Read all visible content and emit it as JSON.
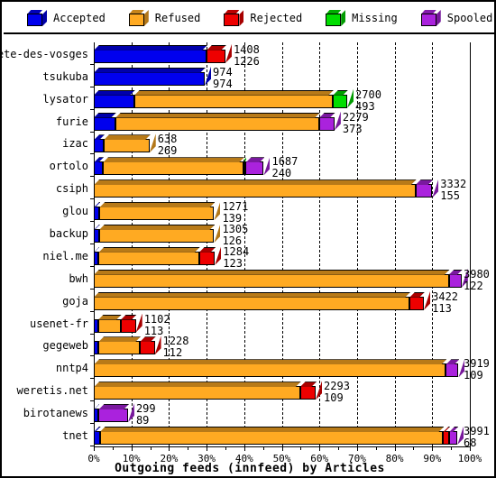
{
  "legend": {
    "items": [
      {
        "label": "Accepted",
        "color": "#0000ee",
        "icon": "cube-icon"
      },
      {
        "label": "Refused",
        "color": "#ffaa22",
        "icon": "cube-icon"
      },
      {
        "label": "Rejected",
        "color": "#ee0000",
        "icon": "cube-icon"
      },
      {
        "label": "Missing",
        "color": "#00dd00",
        "icon": "cube-icon"
      },
      {
        "label": "Spooled",
        "color": "#aa22dd",
        "icon": "cube-icon"
      }
    ]
  },
  "axis": {
    "x_ticks": [
      "0%",
      "10%",
      "20%",
      "30%",
      "40%",
      "50%",
      "60%",
      "70%",
      "80%",
      "90%",
      "100%"
    ],
    "title": "Outgoing feeds (innfeed) by Articles"
  },
  "chart_data": {
    "type": "bar",
    "orientation": "horizontal",
    "stacked": true,
    "title": "Outgoing feeds (innfeed) by Articles",
    "xlabel": "Outgoing feeds (innfeed) by Articles",
    "ylabel": "",
    "xlim": [
      0,
      100
    ],
    "x_unit": "percent",
    "grid": true,
    "legend_position": "top",
    "series_names": [
      "Accepted",
      "Refused",
      "Rejected",
      "Missing",
      "Spooled"
    ],
    "series_colors": [
      "#0000ee",
      "#ffaa22",
      "#ee0000",
      "#00dd00",
      "#aa22dd"
    ],
    "categories": [
      "bete-des-vosges",
      "tsukuba",
      "lysator",
      "furie",
      "izac",
      "ortolo",
      "csiph",
      "glou",
      "backup",
      "niel.me",
      "bwh",
      "goja",
      "usenet-fr",
      "gegeweb",
      "nntp4",
      "weretis.net",
      "birotanews",
      "tnet"
    ],
    "rows": [
      {
        "category": "bete-des-vosges",
        "label_top": "1408",
        "label_bottom": "1226",
        "segments": [
          {
            "name": "Accepted",
            "pct": 30.0
          },
          {
            "name": "Rejected",
            "pct": 5.0
          }
        ]
      },
      {
        "category": "tsukuba",
        "label_top": "974",
        "label_bottom": "974",
        "segments": [
          {
            "name": "Accepted",
            "pct": 29.5
          }
        ]
      },
      {
        "category": "lysator",
        "label_top": "2700",
        "label_bottom": "493",
        "segments": [
          {
            "name": "Accepted",
            "pct": 10.8
          },
          {
            "name": "Refused",
            "pct": 52.8
          },
          {
            "name": "Missing",
            "pct": 3.8
          }
        ]
      },
      {
        "category": "furie",
        "label_top": "2279",
        "label_bottom": "373",
        "segments": [
          {
            "name": "Accepted",
            "pct": 5.8
          },
          {
            "name": "Refused",
            "pct": 54.2
          },
          {
            "name": "Spooled",
            "pct": 4.0
          }
        ]
      },
      {
        "category": "izac",
        "label_top": "638",
        "label_bottom": "269",
        "segments": [
          {
            "name": "Accepted",
            "pct": 2.6
          },
          {
            "name": "Refused",
            "pct": 12.2
          }
        ]
      },
      {
        "category": "ortolo",
        "label_top": "1687",
        "label_bottom": "240",
        "segments": [
          {
            "name": "Accepted",
            "pct": 2.4
          },
          {
            "name": "Refused",
            "pct": 37.4
          },
          {
            "name": "Missing",
            "pct": 0.6
          },
          {
            "name": "Spooled",
            "pct": 4.8
          }
        ]
      },
      {
        "category": "csiph",
        "label_top": "3332",
        "label_bottom": "155",
        "segments": [
          {
            "name": "Refused",
            "pct": 85.5
          },
          {
            "name": "Spooled",
            "pct": 4.5
          }
        ]
      },
      {
        "category": "glou",
        "label_top": "1271",
        "label_bottom": "139",
        "segments": [
          {
            "name": "Accepted",
            "pct": 1.5
          },
          {
            "name": "Refused",
            "pct": 30.5
          }
        ]
      },
      {
        "category": "backup",
        "label_top": "1305",
        "label_bottom": "126",
        "segments": [
          {
            "name": "Accepted",
            "pct": 1.4
          },
          {
            "name": "Refused",
            "pct": 30.6
          }
        ]
      },
      {
        "category": "niel.me",
        "label_top": "1284",
        "label_bottom": "123",
        "segments": [
          {
            "name": "Accepted",
            "pct": 1.3
          },
          {
            "name": "Refused",
            "pct": 26.7
          },
          {
            "name": "Rejected",
            "pct": 4.2
          }
        ]
      },
      {
        "category": "bwh",
        "label_top": "3980",
        "label_bottom": "122",
        "segments": [
          {
            "name": "Refused",
            "pct": 94.4
          },
          {
            "name": "Spooled",
            "pct": 3.4
          }
        ]
      },
      {
        "category": "goja",
        "label_top": "3422",
        "label_bottom": "113",
        "segments": [
          {
            "name": "Refused",
            "pct": 84.0
          },
          {
            "name": "Rejected",
            "pct": 3.8
          }
        ]
      },
      {
        "category": "usenet-fr",
        "label_top": "1102",
        "label_bottom": "113",
        "segments": [
          {
            "name": "Accepted",
            "pct": 1.2
          },
          {
            "name": "Refused",
            "pct": 6.0
          },
          {
            "name": "Rejected",
            "pct": 4.0
          }
        ]
      },
      {
        "category": "gegeweb",
        "label_top": "1228",
        "label_bottom": "112",
        "segments": [
          {
            "name": "Accepted",
            "pct": 1.2
          },
          {
            "name": "Refused",
            "pct": 11.0
          },
          {
            "name": "Rejected",
            "pct": 4.0
          }
        ]
      },
      {
        "category": "nntp4",
        "label_top": "3919",
        "label_bottom": "109",
        "segments": [
          {
            "name": "Refused",
            "pct": 93.6
          },
          {
            "name": "Spooled",
            "pct": 3.4
          }
        ]
      },
      {
        "category": "weretis.net",
        "label_top": "2293",
        "label_bottom": "109",
        "segments": [
          {
            "name": "Refused",
            "pct": 54.8
          },
          {
            "name": "Rejected",
            "pct": 4.2
          }
        ]
      },
      {
        "category": "birotanews",
        "label_top": "299",
        "label_bottom": "89",
        "segments": [
          {
            "name": "Accepted",
            "pct": 1.3
          },
          {
            "name": "Spooled",
            "pct": 7.8
          }
        ]
      },
      {
        "category": "tnet",
        "label_top": "3991",
        "label_bottom": "68",
        "segments": [
          {
            "name": "Accepted",
            "pct": 1.6
          },
          {
            "name": "Refused",
            "pct": 91.3
          },
          {
            "name": "Rejected",
            "pct": 1.6
          },
          {
            "name": "Spooled",
            "pct": 2.2
          }
        ]
      }
    ]
  }
}
